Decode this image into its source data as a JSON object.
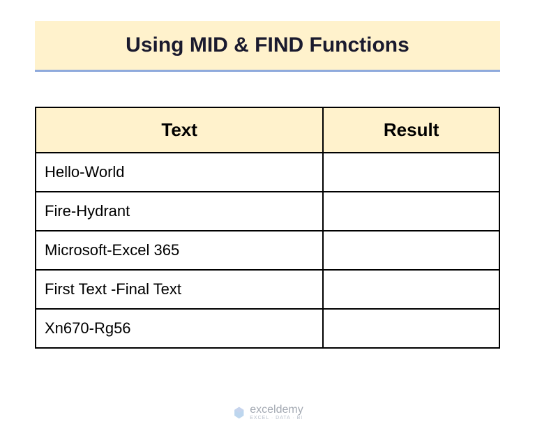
{
  "title": "Using MID & FIND Functions",
  "table": {
    "headers": [
      "Text",
      "Result"
    ],
    "rows": [
      {
        "text": "Hello-World",
        "result": ""
      },
      {
        "text": "Fire-Hydrant",
        "result": ""
      },
      {
        "text": "Microsoft-Excel 365",
        "result": ""
      },
      {
        "text": "First Text -Final Text",
        "result": ""
      },
      {
        "text": "Xn670-Rg56",
        "result": ""
      }
    ]
  },
  "watermark": {
    "main": "exceldemy",
    "sub": "EXCEL · DATA · BI"
  }
}
